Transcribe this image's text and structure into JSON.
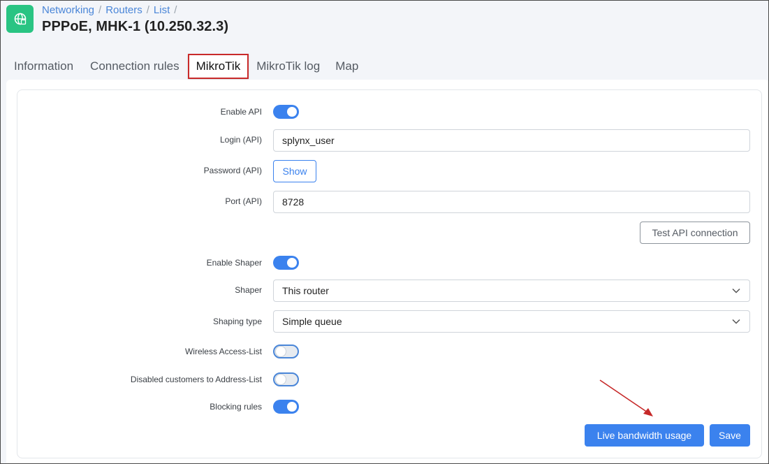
{
  "header": {
    "breadcrumb": [
      "Networking",
      "Routers",
      "List"
    ],
    "separator": "/",
    "title": "PPPoE, MHK-1 (10.250.32.3)",
    "app_icon": "globe-icon",
    "accent_color": "#29c483"
  },
  "tabs": [
    {
      "label": "Information",
      "active": false
    },
    {
      "label": "Connection rules",
      "active": false
    },
    {
      "label": "MikroTik",
      "active": true
    },
    {
      "label": "MikroTik log",
      "active": false
    },
    {
      "label": "Map",
      "active": false
    }
  ],
  "form": {
    "enable_api": {
      "label": "Enable API",
      "on": true
    },
    "login": {
      "label": "Login (API)",
      "value": "splynx_user"
    },
    "password": {
      "label": "Password (API)",
      "button": "Show"
    },
    "port": {
      "label": "Port (API)",
      "value": "8728"
    },
    "test_button": "Test API connection",
    "enable_shaper": {
      "label": "Enable Shaper",
      "on": true
    },
    "shaper": {
      "label": "Shaper",
      "value": "This router"
    },
    "shaping_type": {
      "label": "Shaping type",
      "value": "Simple queue"
    },
    "wireless_access_list": {
      "label": "Wireless Access-List",
      "on": false
    },
    "disabled_customers": {
      "label": "Disabled customers to Address-List",
      "on": false
    },
    "blocking_rules": {
      "label": "Blocking rules",
      "on": true
    }
  },
  "actions": {
    "live_bandwidth": "Live bandwidth usage",
    "save": "Save"
  },
  "colors": {
    "primary": "#3b82ee",
    "highlight_border": "#c92a2a",
    "arrow": "#c62828"
  }
}
